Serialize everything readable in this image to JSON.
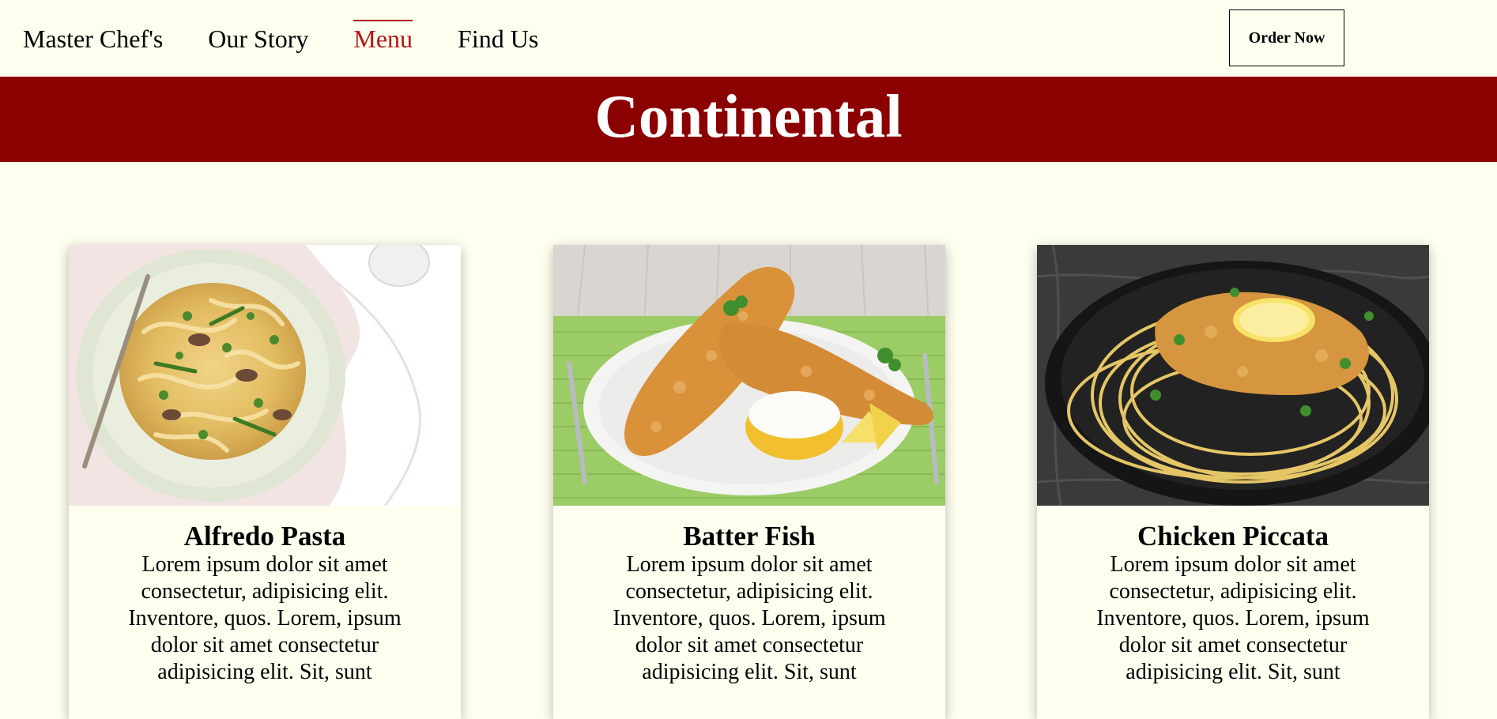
{
  "nav": {
    "items": [
      {
        "label": "Master Chef's",
        "active": false
      },
      {
        "label": "Our Story",
        "active": false
      },
      {
        "label": "Menu",
        "active": true
      },
      {
        "label": "Find Us",
        "active": false
      }
    ],
    "order_label": "Order Now"
  },
  "banner": {
    "title": "Continental"
  },
  "cards": [
    {
      "title": "Alfredo Pasta",
      "text": "Lorem ipsum dolor sit amet consectetur, adipisicing elit. Inventore, quos. Lorem, ipsum dolor sit amet consectetur adipisicing elit. Sit, sunt",
      "image": "alfredo-pasta-photo"
    },
    {
      "title": "Batter Fish",
      "text": "Lorem ipsum dolor sit amet consectetur, adipisicing elit. Inventore, quos. Lorem, ipsum dolor sit amet consectetur adipisicing elit. Sit, sunt",
      "image": "batter-fish-photo"
    },
    {
      "title": "Chicken Piccata",
      "text": "Lorem ipsum dolor sit amet consectetur, adipisicing elit. Inventore, quos. Lorem, ipsum dolor sit amet consectetur adipisicing elit. Sit, sunt",
      "image": "chicken-piccata-photo"
    }
  ],
  "colors": {
    "background": "#fffff0",
    "banner": "#8b0000",
    "active_link": "#b01818",
    "text": "#000000"
  }
}
